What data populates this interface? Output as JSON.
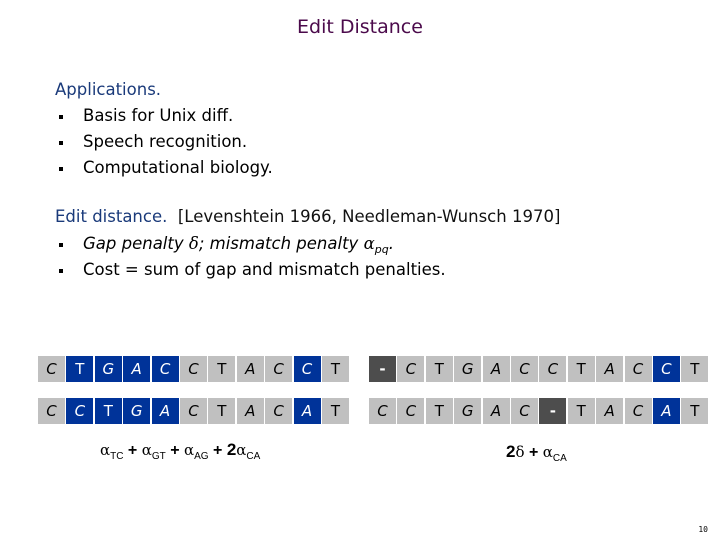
{
  "title": "Edit Distance",
  "applications": {
    "heading": "Applications.",
    "items": [
      "Basis for Unix diff.",
      "Speech recognition.",
      "Computational biology."
    ]
  },
  "edit_distance": {
    "heading": "Edit distance.",
    "citation": "[Levenshtein 1966, Needleman-Wunsch 1970]",
    "items": [
      {
        "pre": "Gap penalty ",
        "delta": "δ",
        "mid": "; mismatch penalty ",
        "alpha": "α",
        "sub": "pq",
        "post": "."
      },
      {
        "text": "Cost = sum of gap and mismatch penalties."
      }
    ]
  },
  "alignments": [
    {
      "name": "alignment-1",
      "top": [
        {
          "ch": "C",
          "type": "match",
          "italic": true
        },
        {
          "ch": "T",
          "type": "mismatch",
          "italic": false
        },
        {
          "ch": "G",
          "type": "mismatch",
          "italic": true
        },
        {
          "ch": "A",
          "type": "mismatch",
          "italic": true
        },
        {
          "ch": "C",
          "type": "mismatch",
          "italic": true
        },
        {
          "ch": "C",
          "type": "match",
          "italic": true
        },
        {
          "ch": "T",
          "type": "match",
          "italic": false
        },
        {
          "ch": "A",
          "type": "match",
          "italic": true
        },
        {
          "ch": "C",
          "type": "match",
          "italic": true
        },
        {
          "ch": "C",
          "type": "mismatch",
          "italic": true
        },
        {
          "ch": "T",
          "type": "match",
          "italic": false
        }
      ],
      "bottom": [
        {
          "ch": "C",
          "type": "match",
          "italic": true
        },
        {
          "ch": "C",
          "type": "mismatch",
          "italic": true
        },
        {
          "ch": "T",
          "type": "mismatch",
          "italic": false
        },
        {
          "ch": "G",
          "type": "mismatch",
          "italic": true
        },
        {
          "ch": "A",
          "type": "mismatch",
          "italic": true
        },
        {
          "ch": "C",
          "type": "match",
          "italic": true
        },
        {
          "ch": "T",
          "type": "match",
          "italic": false
        },
        {
          "ch": "A",
          "type": "match",
          "italic": true
        },
        {
          "ch": "C",
          "type": "match",
          "italic": true
        },
        {
          "ch": "A",
          "type": "mismatch",
          "italic": true
        },
        {
          "ch": "T",
          "type": "match",
          "italic": false
        }
      ],
      "cost": {
        "terms": [
          {
            "sym": "α",
            "sub": "TC"
          },
          {
            "op": "+"
          },
          {
            "sym": "α",
            "sub": "GT"
          },
          {
            "op": "+"
          },
          {
            "sym": "α",
            "sub": "AG"
          },
          {
            "op": "+"
          },
          {
            "coef": "2",
            "sym": "α",
            "sub": "CA"
          }
        ]
      }
    },
    {
      "name": "alignment-2",
      "top": [
        {
          "ch": "-",
          "type": "gap",
          "italic": false
        },
        {
          "ch": "C",
          "type": "match",
          "italic": true
        },
        {
          "ch": "T",
          "type": "match",
          "italic": false
        },
        {
          "ch": "G",
          "type": "match",
          "italic": true
        },
        {
          "ch": "A",
          "type": "match",
          "italic": true
        },
        {
          "ch": "C",
          "type": "match",
          "italic": true
        },
        {
          "ch": "C",
          "type": "match",
          "italic": true
        },
        {
          "ch": "T",
          "type": "match",
          "italic": false
        },
        {
          "ch": "A",
          "type": "match",
          "italic": true
        },
        {
          "ch": "C",
          "type": "match",
          "italic": true
        },
        {
          "ch": "C",
          "type": "mismatch",
          "italic": true
        },
        {
          "ch": "T",
          "type": "match",
          "italic": false
        }
      ],
      "bottom": [
        {
          "ch": "C",
          "type": "match",
          "italic": true
        },
        {
          "ch": "C",
          "type": "match",
          "italic": true
        },
        {
          "ch": "T",
          "type": "match",
          "italic": false
        },
        {
          "ch": "G",
          "type": "match",
          "italic": true
        },
        {
          "ch": "A",
          "type": "match",
          "italic": true
        },
        {
          "ch": "C",
          "type": "match",
          "italic": true
        },
        {
          "ch": "-",
          "type": "gap",
          "italic": false
        },
        {
          "ch": "T",
          "type": "match",
          "italic": false
        },
        {
          "ch": "A",
          "type": "match",
          "italic": true
        },
        {
          "ch": "C",
          "type": "match",
          "italic": true
        },
        {
          "ch": "A",
          "type": "mismatch",
          "italic": true
        },
        {
          "ch": "T",
          "type": "match",
          "italic": false
        }
      ],
      "cost": {
        "terms": [
          {
            "coef": "2",
            "sym": "δ"
          },
          {
            "op": "+"
          },
          {
            "sym": "α",
            "sub": "CA"
          }
        ]
      }
    }
  ],
  "colors": {
    "title": "#4b0a4b",
    "heading": "#1a3a7a",
    "match_cell": "#c0c0c0",
    "mismatch_cell": "#003399",
    "gap_cell": "#4d4d4d"
  },
  "page_number": "10"
}
